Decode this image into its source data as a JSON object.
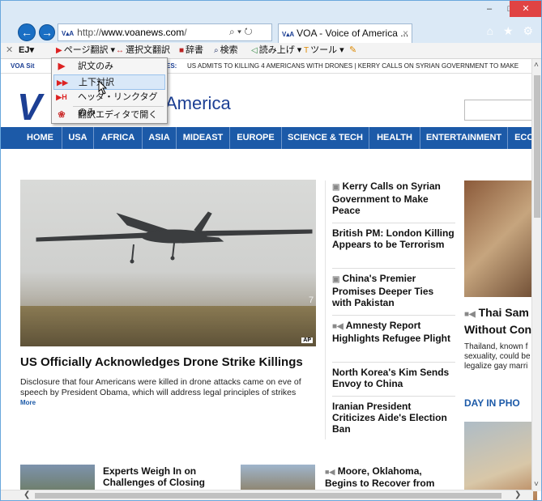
{
  "browser": {
    "url_host": "www.voanews.com",
    "url_prefix": "http://",
    "url_suffix": "/",
    "tab_title": "VOA - Voice of America ...",
    "tab_badge": "V▴A",
    "addr_badge": "V▴A",
    "search_icon": "⌕ ▾",
    "refresh_icon": "↻",
    "close_tab": "×",
    "window_controls": {
      "minimize": "–",
      "maximize": "□",
      "close": "✕"
    },
    "right_icons": "⌂ ★ ⚙"
  },
  "toolbar": {
    "close": "✕",
    "ej": "EJ▾",
    "page_translate": "ページ翻訳 ▾",
    "selection_translate": "選択文翻訳",
    "dictionary": "辞書",
    "search": "検索",
    "read_aloud": "読み上げ ▾",
    "tools": "ツール ▾"
  },
  "menu": {
    "items": [
      {
        "label": "訳文のみ",
        "icon": "▶"
      },
      {
        "label": "上下対訳",
        "icon": "▶▶"
      },
      {
        "label": "ヘッダ・リンクタグのみ",
        "icon": "▶H"
      },
      {
        "label": "翻訳エディタで開く",
        "icon": "❀"
      }
    ]
  },
  "ticker": {
    "site_label": "VOA  Sit",
    "colon": "ES:",
    "headline": "US ADMITS TO KILLING 4 AMERICANS WITH DRONES  |  KERRY CALLS ON SYRIAN GOVERNMENT TO MAKE"
  },
  "site": {
    "logo": "V",
    "logo_text": "America"
  },
  "nav": [
    "HOME",
    "USA",
    "AFRICA",
    "ASIA",
    "MIDEAST",
    "EUROPE",
    "SCIENCE & TECH",
    "HEALTH",
    "ENTERTAINMENT",
    "ECO"
  ],
  "hero": {
    "credit": "AP",
    "headline": "US Officially Acknowledges Drone Strike Killings",
    "summary": "Disclosure that four Americans were killed in drone attacks came on eve of speech by President Obama, which will address legal principles of strikes",
    "more": "More"
  },
  "sidebar_stories": [
    {
      "icon": "▣",
      "title": "Kerry Calls on Syrian Government to Make Peace"
    },
    {
      "icon": "",
      "title": "British PM: London Killing Appears to be Terrorism"
    },
    {
      "icon": "▣",
      "title": "China's Premier Promises Deeper Ties with Pakistan"
    },
    {
      "icon": "■◀",
      "title": "Amnesty Report Highlights Refugee Plight"
    },
    {
      "icon": "",
      "title": "North Korea's Kim Sends Envoy to China"
    },
    {
      "icon": "",
      "title": "Iranian President Criticizes Aide's Election Ban"
    }
  ],
  "right_col": {
    "title_icon": "■◀",
    "title_line1": "Thai Sam",
    "title_line2": "Without Con",
    "summary_lines": [
      "Thailand, known f",
      "sexuality, could be",
      "legalize gay marri"
    ],
    "section": "DAY IN PHO"
  },
  "bottom": {
    "left_title": "Experts Weigh In on Challenges of Closing",
    "right_icon": "■◀",
    "right_title": "Moore, Oklahoma, Begins to Recover from"
  },
  "scroll": {
    "left": "❮",
    "right": "❯",
    "up": "˄",
    "down": "˅"
  }
}
